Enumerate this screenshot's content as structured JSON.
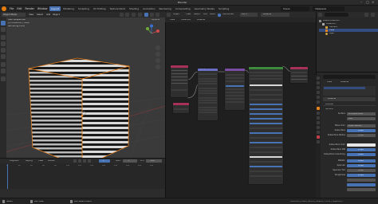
{
  "window": {
    "title": "Blender"
  },
  "menu": {
    "items": [
      "File",
      "Edit",
      "Render",
      "Window",
      "Help"
    ],
    "tabs": [
      "Layout",
      "Modeling",
      "Sculpting",
      "UV Editing",
      "Texture Paint",
      "Shading",
      "Animation",
      "Rendering",
      "Compositing",
      "Geometry Nodes",
      "Scripting"
    ],
    "active_tab": "Layout",
    "scene": "Scene",
    "view_layer": "ViewLayer"
  },
  "viewport": {
    "mode": "Object Mode",
    "menus": [
      "View",
      "Select",
      "Add",
      "Object"
    ],
    "overlay_lines": [
      "User Perspective",
      "(1) Collection | Cube",
      "Rendering Done"
    ],
    "options_label": "Options"
  },
  "timeline": {
    "menus": [
      "Playback",
      "Keying",
      "View",
      "Marker"
    ],
    "frame_current": "1",
    "start_label": "Start",
    "start_value": "1",
    "end_label": "End",
    "end_value": "250",
    "ticks": [
      "0",
      "20",
      "40",
      "60",
      "80",
      "100",
      "120",
      "140",
      "160",
      "180",
      "200",
      "220",
      "240"
    ]
  },
  "status": {
    "left": "Select",
    "middle": "Pan View",
    "right_hint": "Box Select Menu",
    "version": "Collection | Cube | Verts:8 | Faces:6 | Tris:12 | Objects:1/3"
  },
  "node_editor": {
    "menus": [
      "Object",
      "View",
      "Select",
      "Add",
      "Node"
    ],
    "use_nodes": "Use Nodes",
    "slot": "Slot 1",
    "material": "Material",
    "breadcrumb": [
      "Cube",
      "Cube.001",
      "Material"
    ],
    "nodes": [
      {
        "title": "Texture Coordinate",
        "color": "#a8315a"
      },
      {
        "title": "Mapping",
        "color": "#6b70c4"
      },
      {
        "title": "Wave Texture",
        "color": "#7b4ea3"
      },
      {
        "title": "Principled BSDF",
        "color": "#3d8a3d"
      },
      {
        "title": "Material Output",
        "color": "#a8315a"
      },
      {
        "title": "Value",
        "color": "#a8315a"
      }
    ]
  },
  "outliner": {
    "title": "Scene Collection",
    "items": [
      "Collection",
      "Camera",
      "Cube",
      "Light"
    ]
  },
  "properties": {
    "breadcrumb": [
      "Cube",
      "Material"
    ],
    "material_name": "Material",
    "panel_preview": "Preview",
    "panel_surface": "Surface",
    "surface_shader": "Principled BSDF",
    "labels": [
      "Surface",
      "",
      "Base Color",
      "Subsurface",
      "Subsurface Radius",
      "Subsurface Color",
      "Subsurface IOR",
      "Subsurface Anisotropy",
      "Metallic",
      "Specular",
      "Specular Tint",
      "Roughness"
    ],
    "values": [
      "Principled BSDF",
      "GGX",
      "Wave Texture",
      "0.000",
      "1.000",
      "",
      "1.400",
      "0.000",
      "0.000",
      "0.500",
      "0.000",
      "0.500"
    ]
  },
  "colors": {
    "accent": "#4772b3",
    "cube_outline": "#e8821f",
    "background": "#3a3a3a"
  }
}
